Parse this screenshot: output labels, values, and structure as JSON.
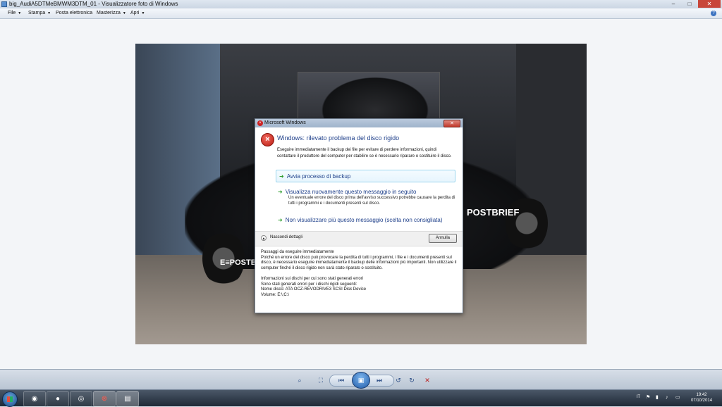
{
  "window": {
    "title": "big_AudiA5DTMeBMWM3DTM_01 - Visualizzatore foto di Windows"
  },
  "menu": [
    {
      "label": "File"
    },
    {
      "label": "Stampa"
    },
    {
      "label": "Posta elettronica"
    },
    {
      "label": "Masterizza"
    },
    {
      "label": "Apri"
    }
  ],
  "photo": {
    "brand1": "E≡POSTBRIEF",
    "brand2": "POSTBRIEF"
  },
  "dialog": {
    "title": "Microsoft Windows",
    "heading": "Windows: rilevato problema del disco rigido",
    "intro": "Eseguire immediatamente il backup dei file per evitare di perdere informazioni, quindi contattare il produttore del computer per stabilire se è necessario riparare o sostituire il disco.",
    "options": [
      {
        "label": "Avvia processo di backup",
        "sub": ""
      },
      {
        "label": "Visualizza nuovamente questo messaggio in seguito",
        "sub": "Un eventuale errore del disco prima dell'avviso successivo potrebbe causare la perdita di tutti i programmi e i documenti presenti sul disco."
      },
      {
        "label": "Non visualizzare più questo messaggio (scelta non consigliata)",
        "sub": ""
      }
    ],
    "details_toggle": "Nascondi dettagli",
    "cancel_button": "Annulla",
    "details": {
      "section1_title": "Passaggi da eseguire immediatamente",
      "section1_body": "Poiché un errore del disco può provocare la perdita di tutti i programmi, i file e i documenti presenti sul disco, è necessario eseguire immediatamente il backup delle informazioni più importanti. Non utilizzare il computer finché il disco rigido non sarà stato riparato o sostituito.",
      "section2_title": "Informazioni sui dischi per cui sono stati generati errori",
      "line1": "Sono stati generati errori per i dischi rigidi seguenti:",
      "line2": "Nome disco: ATA OCZ-REVODRIVE3 SCSI Disk Device",
      "line3": "Volume: E:\\;C:\\"
    }
  },
  "taskbar": {
    "language": "IT",
    "time": "19:42",
    "date": "07/10/2014",
    "apps": [
      "explorer-icon",
      "firefox-icon",
      "media-icon",
      "chrome-icon",
      "error-icon",
      "photo-viewer-icon"
    ]
  },
  "colors": {
    "accent": "#1e3f8a",
    "error": "#c0392b",
    "link_green": "#2a9b2a"
  }
}
